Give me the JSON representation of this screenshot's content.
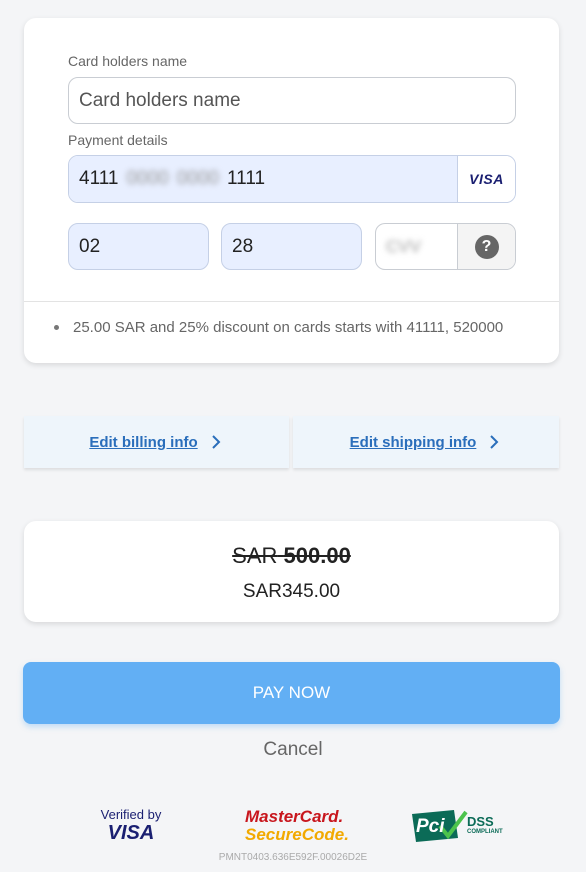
{
  "card_form": {
    "holder_label": "Card holders name",
    "holder_placeholder": "Card holders name",
    "holder_value": "",
    "payment_label": "Payment details",
    "pan_first": "4111",
    "pan_masked_1": "0000",
    "pan_masked_2": "0000",
    "pan_last": "1111",
    "brand": "VISA",
    "exp_month": "02",
    "exp_year": "28",
    "cvv_placeholder": "CVV",
    "help_symbol": "?",
    "discount_note": "25.00 SAR and 25% discount on cards starts with 41111, 520000"
  },
  "links": {
    "billing": "Edit billing info",
    "shipping": "Edit shipping info"
  },
  "price": {
    "old_currency": "SAR",
    "old_amount": "500.00",
    "new_price": "SAR345.00"
  },
  "actions": {
    "pay": "PAY NOW",
    "cancel": "Cancel"
  },
  "logos": {
    "verified_line1": "Verified by",
    "verified_line2": "VISA",
    "mc_line1": "MasterCard.",
    "mc_line2": "SecureCode.",
    "pci": "Pci",
    "dss": "DSS",
    "compliant": "COMPLIANT"
  },
  "reference": "PMNT0403.636E592F.00026D2E",
  "colors": {
    "accent": "#62aff4",
    "link": "#2a6ebb",
    "visa_blue": "#1a1f71"
  }
}
